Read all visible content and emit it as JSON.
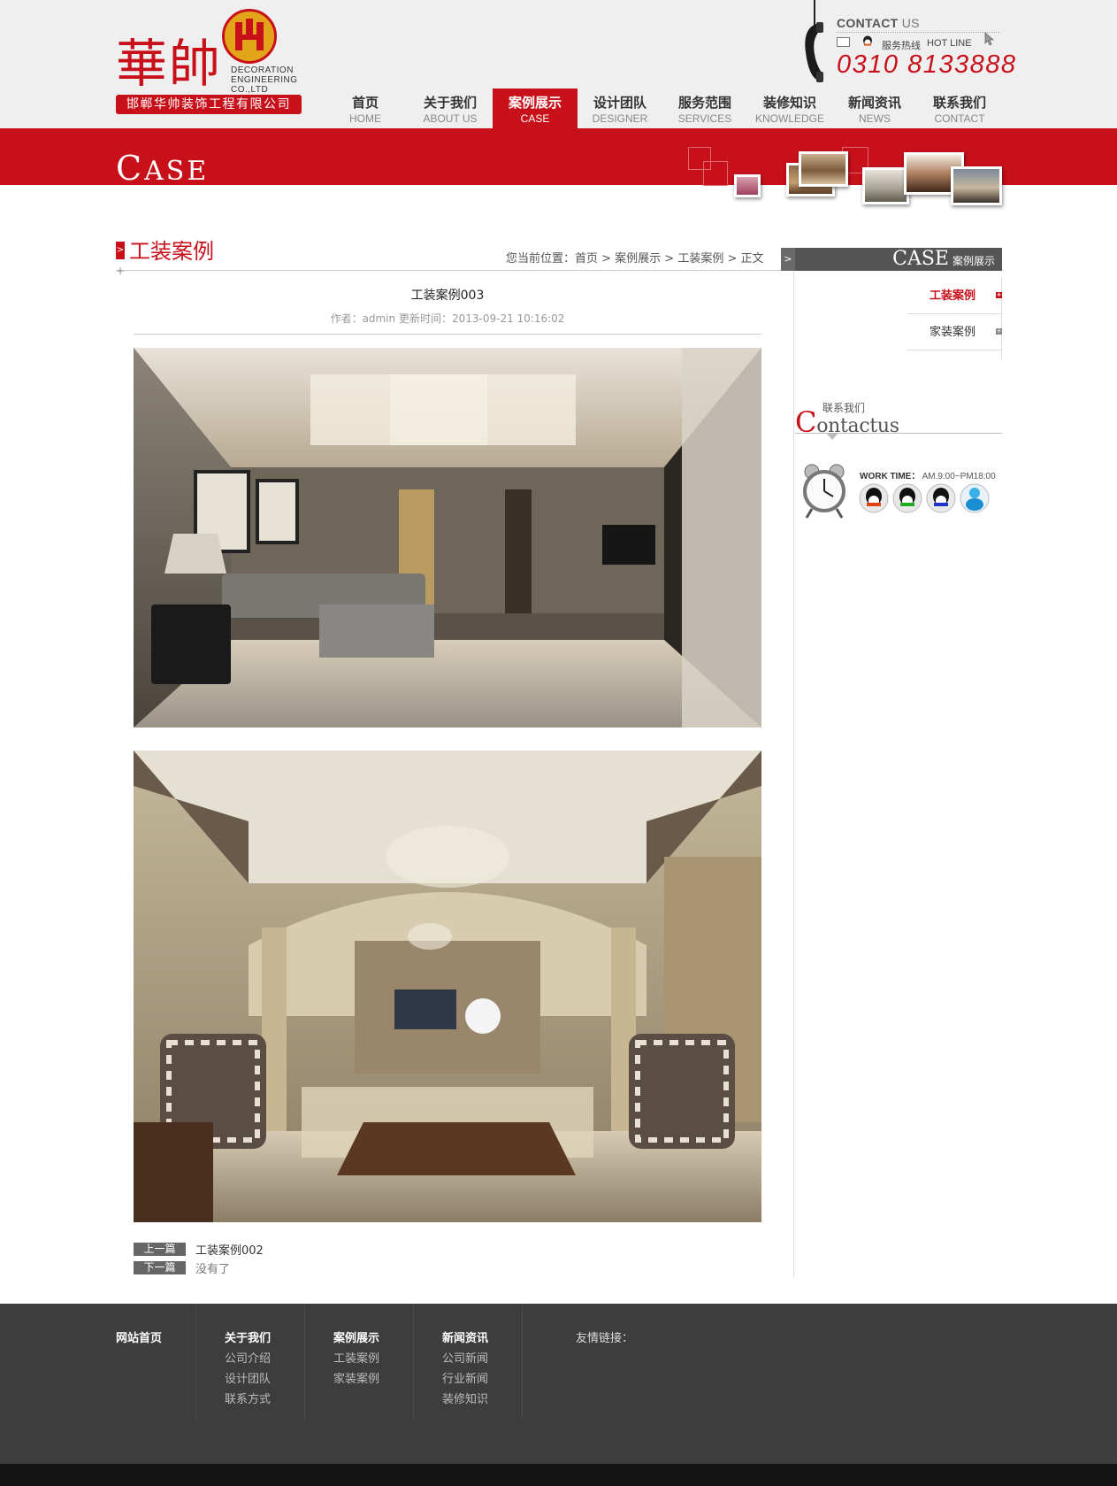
{
  "logo": {
    "chinese_name": "華帥",
    "english_lines": [
      "DECORATION",
      "ENGINEERING",
      "CO.,LTD"
    ],
    "company_full": "邯郸华帅装饰工程有限公司"
  },
  "contact_header": {
    "title_bold": "CONTACT",
    "title_light": " US",
    "hotline_cn": "服务热线",
    "hotline_en": "HOT LINE",
    "phone": "0310 8133888"
  },
  "nav": [
    {
      "cn": "首页",
      "en": "HOME",
      "active": false
    },
    {
      "cn": "关于我们",
      "en": "ABOUT US",
      "active": false
    },
    {
      "cn": "案例展示",
      "en": "CASE",
      "active": true
    },
    {
      "cn": "设计团队",
      "en": "DESIGNER",
      "active": false
    },
    {
      "cn": "服务范围",
      "en": "SERVICES",
      "active": false
    },
    {
      "cn": "装修知识",
      "en": "KNOWLEDGE",
      "active": false
    },
    {
      "cn": "新闻资讯",
      "en": "NEWS",
      "active": false
    },
    {
      "cn": "联系我们",
      "en": "CONTACT",
      "active": false
    }
  ],
  "banner": {
    "title_big": "C",
    "title_rest": "ASE"
  },
  "section": {
    "title": "工装案例",
    "breadcrumb": "您当前位置：首页 > 案例展示 > 工装案例 > 正文"
  },
  "article": {
    "title": "工装案例003",
    "meta": "作者：admin  更新时间：2013-09-21 10:16:02"
  },
  "pager": {
    "prev_label": "上一篇",
    "prev_title": "工装案例002",
    "next_label": "下一篇",
    "next_title": "没有了"
  },
  "sidebar": {
    "head_title": "CASE",
    "head_sub": "案例展示",
    "items": [
      {
        "label": "工装案例",
        "active": true
      },
      {
        "label": "家装案例",
        "active": false
      }
    ],
    "contact_cn": "联系我们",
    "contact_big_first": "C",
    "contact_big_rest": "ontactus",
    "work_time_label": "WORK TIME：",
    "work_time_value": "AM.9:00~PM18:00"
  },
  "footer": {
    "col1": {
      "head": "网站首页"
    },
    "col2": {
      "head": "关于我们",
      "links": [
        "公司介绍",
        "设计团队",
        "联系方式"
      ]
    },
    "col3": {
      "head": "案例展示",
      "links": [
        "工装案例",
        "家装案例"
      ]
    },
    "col4": {
      "head": "新闻资讯",
      "links": [
        "公司新闻",
        "行业新闻",
        "装修知识"
      ]
    },
    "friends": "友情链接："
  },
  "colors": {
    "brand_red": "#c8101b",
    "footer_bg": "#3d3d3d",
    "footer_bottom": "#141414"
  }
}
